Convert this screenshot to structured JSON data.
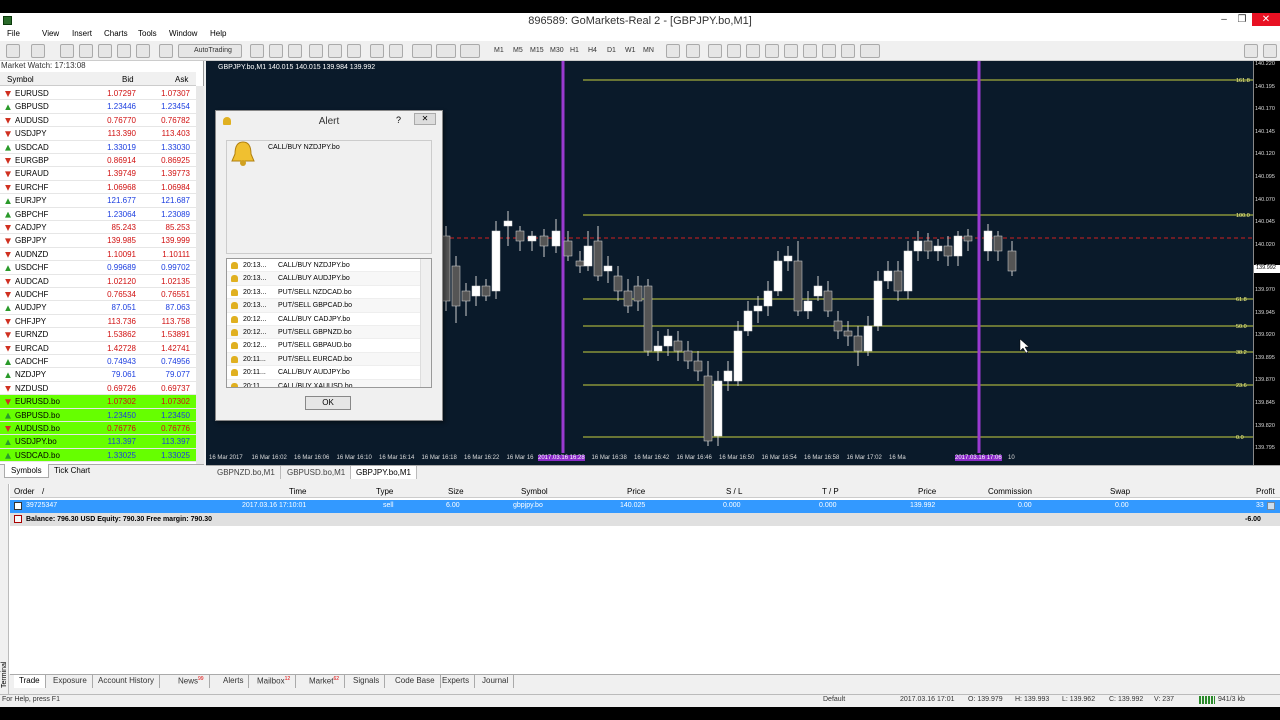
{
  "window": {
    "title": "896589: GoMarkets-Real 2 - [GBPJPY.bo,M1]"
  },
  "menu": [
    "File",
    "View",
    "Insert",
    "Charts",
    "Tools",
    "Window",
    "Help"
  ],
  "toolbar": {
    "autotrading": "AutoTrading",
    "timeframes": [
      "M1",
      "M5",
      "M15",
      "M30",
      "H1",
      "H4",
      "D1",
      "W1",
      "MN"
    ]
  },
  "market_watch": {
    "title": "Market Watch: 17:13:08",
    "headers": {
      "symbol": "Symbol",
      "bid": "Bid",
      "ask": "Ask"
    },
    "rows": [
      {
        "symbol": "EURUSD",
        "bid": "1.07297",
        "ask": "1.07307",
        "dir": "dn"
      },
      {
        "symbol": "GBPUSD",
        "bid": "1.23446",
        "ask": "1.23454",
        "dir": "up"
      },
      {
        "symbol": "AUDUSD",
        "bid": "0.76770",
        "ask": "0.76782",
        "dir": "dn"
      },
      {
        "symbol": "USDJPY",
        "bid": "113.390",
        "ask": "113.403",
        "dir": "dn"
      },
      {
        "symbol": "USDCAD",
        "bid": "1.33019",
        "ask": "1.33030",
        "dir": "up"
      },
      {
        "symbol": "EURGBP",
        "bid": "0.86914",
        "ask": "0.86925",
        "dir": "dn"
      },
      {
        "symbol": "EURAUD",
        "bid": "1.39749",
        "ask": "1.39773",
        "dir": "dn"
      },
      {
        "symbol": "EURCHF",
        "bid": "1.06968",
        "ask": "1.06984",
        "dir": "dn"
      },
      {
        "symbol": "EURJPY",
        "bid": "121.677",
        "ask": "121.687",
        "dir": "up"
      },
      {
        "symbol": "GBPCHF",
        "bid": "1.23064",
        "ask": "1.23089",
        "dir": "up"
      },
      {
        "symbol": "CADJPY",
        "bid": "85.243",
        "ask": "85.253",
        "dir": "dn"
      },
      {
        "symbol": "GBPJPY",
        "bid": "139.985",
        "ask": "139.999",
        "dir": "dn"
      },
      {
        "symbol": "AUDNZD",
        "bid": "1.10091",
        "ask": "1.10111",
        "dir": "dn"
      },
      {
        "symbol": "USDCHF",
        "bid": "0.99689",
        "ask": "0.99702",
        "dir": "up"
      },
      {
        "symbol": "AUDCAD",
        "bid": "1.02120",
        "ask": "1.02135",
        "dir": "dn"
      },
      {
        "symbol": "AUDCHF",
        "bid": "0.76534",
        "ask": "0.76551",
        "dir": "dn"
      },
      {
        "symbol": "AUDJPY",
        "bid": "87.051",
        "ask": "87.063",
        "dir": "up"
      },
      {
        "symbol": "CHFJPY",
        "bid": "113.736",
        "ask": "113.758",
        "dir": "dn"
      },
      {
        "symbol": "EURNZD",
        "bid": "1.53862",
        "ask": "1.53891",
        "dir": "dn"
      },
      {
        "symbol": "EURCAD",
        "bid": "1.42728",
        "ask": "1.42741",
        "dir": "dn"
      },
      {
        "symbol": "CADCHF",
        "bid": "0.74943",
        "ask": "0.74956",
        "dir": "up"
      },
      {
        "symbol": "NZDJPY",
        "bid": "79.061",
        "ask": "79.077",
        "dir": "up"
      },
      {
        "symbol": "NZDUSD",
        "bid": "0.69726",
        "ask": "0.69737",
        "dir": "dn"
      },
      {
        "symbol": "EURUSD.bo",
        "bid": "1.07302",
        "ask": "1.07302",
        "dir": "dn",
        "hl": true
      },
      {
        "symbol": "GBPUSD.bo",
        "bid": "1.23450",
        "ask": "1.23450",
        "dir": "up",
        "hl": true
      },
      {
        "symbol": "AUDUSD.bo",
        "bid": "0.76776",
        "ask": "0.76776",
        "dir": "dn",
        "hl": true
      },
      {
        "symbol": "USDJPY.bo",
        "bid": "113.397",
        "ask": "113.397",
        "dir": "up",
        "hl": true
      },
      {
        "symbol": "USDCAD.bo",
        "bid": "1.33025",
        "ask": "1.33025",
        "dir": "up",
        "hl": true
      }
    ],
    "tabs": [
      "Symbols",
      "Tick Chart"
    ]
  },
  "chart": {
    "info": "GBPJPY.bo,M1  140.015 140.015 139.984 139.992",
    "price_labels": [
      "140.220",
      "140.195",
      "140.170",
      "140.145",
      "140.120",
      "140.095",
      "140.070",
      "140.045",
      "140.020",
      "139.992",
      "139.970",
      "139.945",
      "139.920",
      "139.895",
      "139.870",
      "139.845",
      "139.820",
      "139.795"
    ],
    "current_price": "139.992",
    "time_labels": [
      "16 Mar 2017",
      "16 Mar 16:02",
      "16 Mar 16:06",
      "16 Mar 16:10",
      "16 Mar 16:14",
      "16 Mar 16:18",
      "16 Mar 16:22",
      "16 Mar 16",
      "16 Mar 16:34",
      "16 Mar 16:38",
      "16 Mar 16:42",
      "16 Mar 16:46",
      "16 Mar 16:50",
      "16 Mar 16:54",
      "16 Mar 16:58",
      "16 Mar 17:02",
      "16 Ma"
    ],
    "time_tail": "10",
    "highlight_time1": "2017.03.16 16:28",
    "highlight_time2": "2017.03.16 17:06",
    "fib_labels": [
      "161.8",
      "100.0",
      "61.8",
      "50.0",
      "38.2",
      "23.6",
      "0.0"
    ],
    "tabs": [
      "GBPNZD.bo,M1",
      "GBPUSD.bo,M1",
      "GBPJPY.bo,M1"
    ],
    "colors": {
      "bg": "#0a1a2a",
      "fib": "#c8d040",
      "vline": "#9a3ad0",
      "bid": "#d02020"
    }
  },
  "alert": {
    "title": "Alert",
    "help": "?",
    "close": "✕",
    "message": "CALL/BUY NZDJPY.bo",
    "ok": "OK",
    "items": [
      {
        "time": "20:13...",
        "msg": "CALL/BUY NZDJPY.bo"
      },
      {
        "time": "20:13...",
        "msg": "CALL/BUY AUDJPY.bo"
      },
      {
        "time": "20:13...",
        "msg": "PUT/SELL NZDCAD.bo"
      },
      {
        "time": "20:13...",
        "msg": "PUT/SELL GBPCAD.bo"
      },
      {
        "time": "20:12...",
        "msg": "CALL/BUY CADJPY.bo"
      },
      {
        "time": "20:12...",
        "msg": "PUT/SELL GBPNZD.bo"
      },
      {
        "time": "20:12...",
        "msg": "PUT/SELL GBPAUD.bo"
      },
      {
        "time": "20:11...",
        "msg": "PUT/SELL EURCAD.bo"
      },
      {
        "time": "20:11...",
        "msg": "CALL/BUY AUDJPY.bo"
      },
      {
        "time": "20:11...",
        "msg": "CALL/BUY XAUUSD.bo"
      }
    ]
  },
  "terminal": {
    "headers": [
      "Order",
      "/",
      "Time",
      "Type",
      "Size",
      "Symbol",
      "Price",
      "S / L",
      "T / P",
      "Price",
      "Commission",
      "Swap",
      "Profit"
    ],
    "order": {
      "id": "39725347",
      "time": "2017.03.16 17:10:01",
      "type": "sell",
      "size": "6.00",
      "symbol": "gbpjpy.bo",
      "price": "140.025",
      "sl": "0.000",
      "tp": "0.000",
      "cur": "139.992",
      "commission": "0.00",
      "swap": "0.00",
      "profit": "33"
    },
    "balance": "Balance: 796.30 USD  Equity: 790.30  Free margin: 790.30",
    "balance_profit": "-6.00",
    "side_label": "Terminal",
    "tabs": [
      {
        "label": "Trade"
      },
      {
        "label": "Exposure"
      },
      {
        "label": "Account History"
      },
      {
        "label": "News",
        "badge": "99"
      },
      {
        "label": "Alerts"
      },
      {
        "label": "Mailbox",
        "badge": "12"
      },
      {
        "label": "Market",
        "badge": "62"
      },
      {
        "label": "Signals"
      },
      {
        "label": "Code Base"
      },
      {
        "label": "Experts"
      },
      {
        "label": "Journal"
      }
    ]
  },
  "status": {
    "help": "For Help, press F1",
    "profile": "Default",
    "datetime": "2017.03.16 17:01",
    "open": "O: 139.979",
    "high": "H: 139.993",
    "low": "L: 139.962",
    "close": "C: 139.992",
    "volume": "V: 237",
    "traffic": "941/3 kb"
  }
}
